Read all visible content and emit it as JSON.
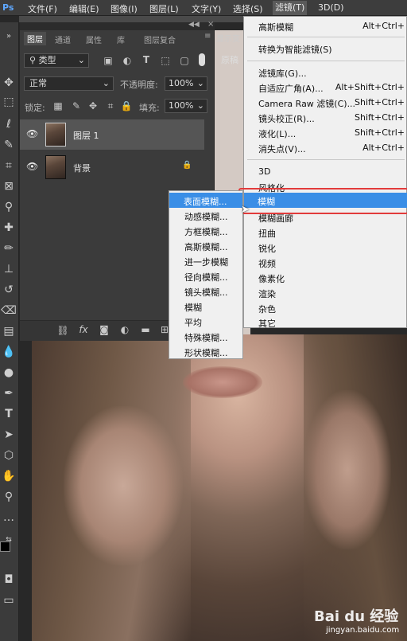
{
  "menubar": {
    "items": [
      "文件(F)",
      "编辑(E)",
      "图像(I)",
      "图层(L)",
      "文字(Y)",
      "选择(S)",
      "滤镜(T)",
      "3D(D)"
    ],
    "active_index": 6
  },
  "panel": {
    "tabs": [
      "图层",
      "通道",
      "属性",
      "库",
      "图层复合"
    ],
    "filter_kind": "类型",
    "blend_mode": "正常",
    "opacity_label": "不透明度:",
    "opacity_value": "100%",
    "lock_label": "锁定:",
    "fill_label": "填充:",
    "fill_value": "100%",
    "layers": [
      {
        "name": "图层 1",
        "selected": true
      },
      {
        "name": "背景",
        "locked": true
      }
    ],
    "right_snippets": [
      "显示变",
      "原稿"
    ]
  },
  "filter_menu": {
    "items": [
      {
        "label": "高斯模糊",
        "shortcut": "Alt+Ctrl+"
      },
      {
        "label": "转换为智能滤镜(S)",
        "shortcut": ""
      },
      {
        "label": "滤镜库(G)...",
        "shortcut": ""
      },
      {
        "label": "自适应广角(A)...",
        "shortcut": "Alt+Shift+Ctrl+"
      },
      {
        "label": "Camera Raw 滤镜(C)...",
        "shortcut": "Shift+Ctrl+"
      },
      {
        "label": "镜头校正(R)...",
        "shortcut": "Shift+Ctrl+"
      },
      {
        "label": "液化(L)...",
        "shortcut": "Shift+Ctrl+"
      },
      {
        "label": "消失点(V)...",
        "shortcut": "Alt+Ctrl+"
      },
      {
        "label": "3D",
        "shortcut": ""
      },
      {
        "label": "风格化",
        "shortcut": ""
      },
      {
        "label": "模糊",
        "shortcut": "",
        "highlighted": true
      },
      {
        "label": "模糊画廊",
        "shortcut": ""
      },
      {
        "label": "扭曲",
        "shortcut": ""
      },
      {
        "label": "锐化",
        "shortcut": ""
      },
      {
        "label": "视频",
        "shortcut": ""
      },
      {
        "label": "像素化",
        "shortcut": ""
      },
      {
        "label": "渲染",
        "shortcut": ""
      },
      {
        "label": "杂色",
        "shortcut": ""
      },
      {
        "label": "其它",
        "shortcut": ""
      }
    ]
  },
  "blur_submenu": {
    "items": [
      "表面模糊...",
      "动感模糊...",
      "方框模糊...",
      "高斯模糊...",
      "进一步模糊",
      "径向模糊...",
      "镜头模糊...",
      "模糊",
      "平均",
      "特殊模糊...",
      "形状模糊..."
    ],
    "highlighted_index": 0
  },
  "watermark": {
    "text": "Bai du 经验",
    "url": "jingyan.baidu.com"
  },
  "colors": {
    "highlight": "#3a8ee6",
    "annotation": "#e23b3b"
  }
}
